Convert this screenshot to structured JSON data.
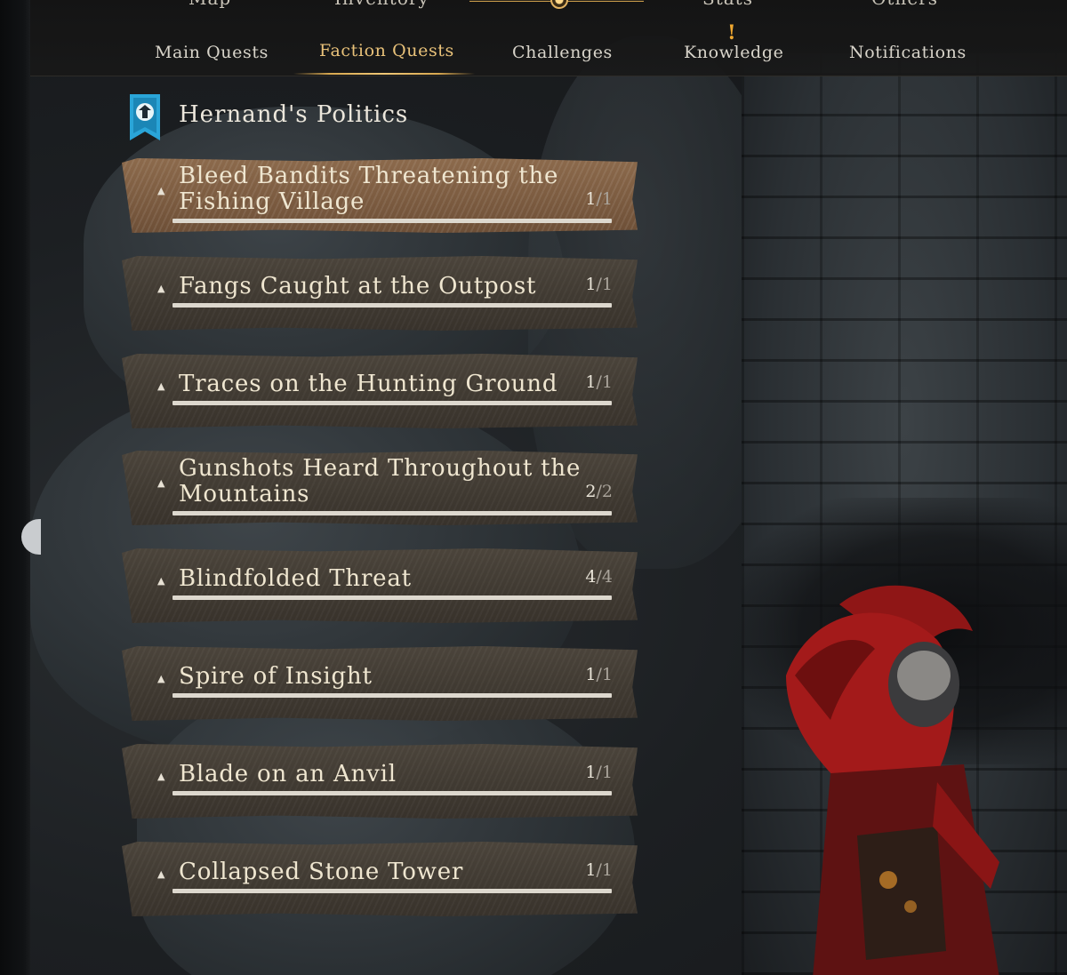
{
  "top_nav": {
    "main_tabs": [
      {
        "label": "Map"
      },
      {
        "label": "Inventory"
      },
      {
        "label": "Stats"
      },
      {
        "label": "Others"
      }
    ],
    "sub_tabs": [
      {
        "label": "Main Quests"
      },
      {
        "label": "Faction Quests",
        "active": true
      },
      {
        "label": "Challenges"
      },
      {
        "label": "Knowledge",
        "alert": "!"
      },
      {
        "label": "Notifications"
      }
    ]
  },
  "faction": {
    "title": "Hernand's Politics",
    "icon": "faction-banner-icon"
  },
  "quests": [
    {
      "name": "Bleed Bandits Threatening the Fishing Village",
      "done": "1",
      "total": "/1",
      "selected": true
    },
    {
      "name": "Fangs Caught at the Outpost",
      "done": "1",
      "total": "/1"
    },
    {
      "name": "Traces on the Hunting Ground",
      "done": "1",
      "total": "/1"
    },
    {
      "name": "Gunshots Heard Throughout the Mountains",
      "done": "2",
      "total": "/2"
    },
    {
      "name": "Blindfolded Threat",
      "done": "4",
      "total": "/4"
    },
    {
      "name": "Spire of Insight",
      "done": "1",
      "total": "/1"
    },
    {
      "name": "Blade on an Anvil",
      "done": "1",
      "total": "/1"
    },
    {
      "name": "Collapsed Stone Tower",
      "done": "1",
      "total": "/1"
    }
  ],
  "colors": {
    "accent_gold": "#e9c27a",
    "alert_orange": "#f0a830",
    "row_normal": "#443e36",
    "row_selected": "#7f5e42"
  }
}
